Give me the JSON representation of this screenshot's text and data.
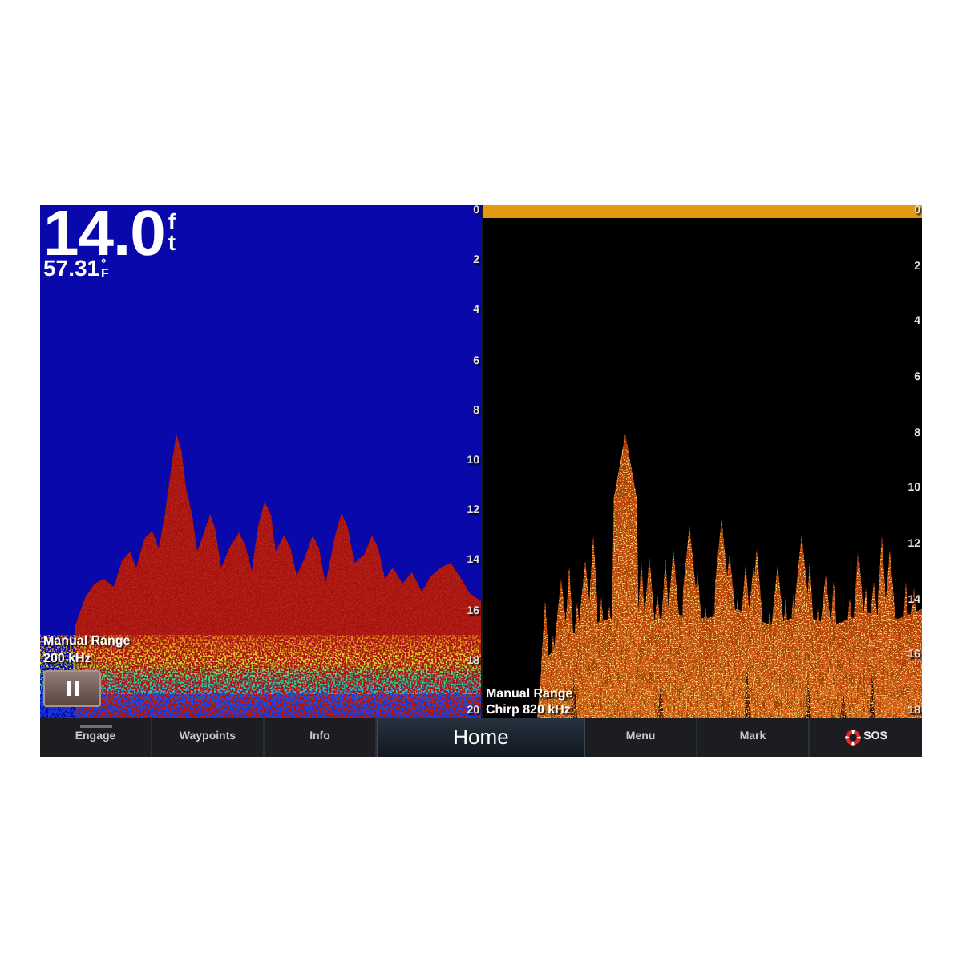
{
  "left_pane": {
    "selected": false,
    "depth_reading": {
      "value": "14.0",
      "unit": "ft"
    },
    "water_temperature": {
      "value": "57.31",
      "unit": "°F"
    },
    "range_mode": "Manual Range",
    "frequency": "200 kHz",
    "depth_scale": [
      "0",
      "2",
      "4",
      "6",
      "8",
      "10",
      "12",
      "14",
      "16",
      "18",
      "20"
    ]
  },
  "right_pane": {
    "selected": true,
    "range_mode": "Manual Range",
    "frequency": "Chirp 820 kHz",
    "depth_scale": [
      "0",
      "2",
      "4",
      "6",
      "8",
      "10",
      "12",
      "14",
      "16",
      "18"
    ]
  },
  "bottom_bar": {
    "buttons": [
      {
        "label": "Engage",
        "kind": "toggle",
        "on": false
      },
      {
        "label": "Waypoints",
        "kind": "plain"
      },
      {
        "label": "Info",
        "kind": "plain"
      },
      {
        "label": "Home",
        "kind": "main"
      },
      {
        "label": "Menu",
        "kind": "plain"
      },
      {
        "label": "Mark",
        "kind": "plain"
      },
      {
        "label": "SOS",
        "kind": "sos"
      }
    ]
  }
}
